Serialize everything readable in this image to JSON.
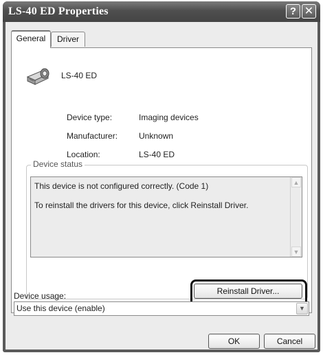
{
  "window": {
    "title": "LS-40 ED Properties",
    "help_glyph": "?",
    "close_glyph": "✕"
  },
  "tabs": [
    {
      "label": "General",
      "active": true
    },
    {
      "label": "Driver",
      "active": false
    }
  ],
  "device": {
    "icon": "scanner-icon",
    "name": "LS-40 ED",
    "properties": [
      {
        "label": "Device type:",
        "value": "Imaging devices"
      },
      {
        "label": "Manufacturer:",
        "value": "Unknown"
      },
      {
        "label": "Location:",
        "value": "LS-40 ED"
      }
    ]
  },
  "device_status": {
    "legend": "Device status",
    "lines": [
      "This device is not configured correctly. (Code 1)",
      "To reinstall the drivers for this device, click Reinstall Driver."
    ],
    "reinstall_label": "Reinstall Driver..."
  },
  "device_usage": {
    "label": "Device usage:",
    "selected": "Use this device (enable)"
  },
  "footer": {
    "ok_label": "OK",
    "cancel_label": "Cancel"
  }
}
